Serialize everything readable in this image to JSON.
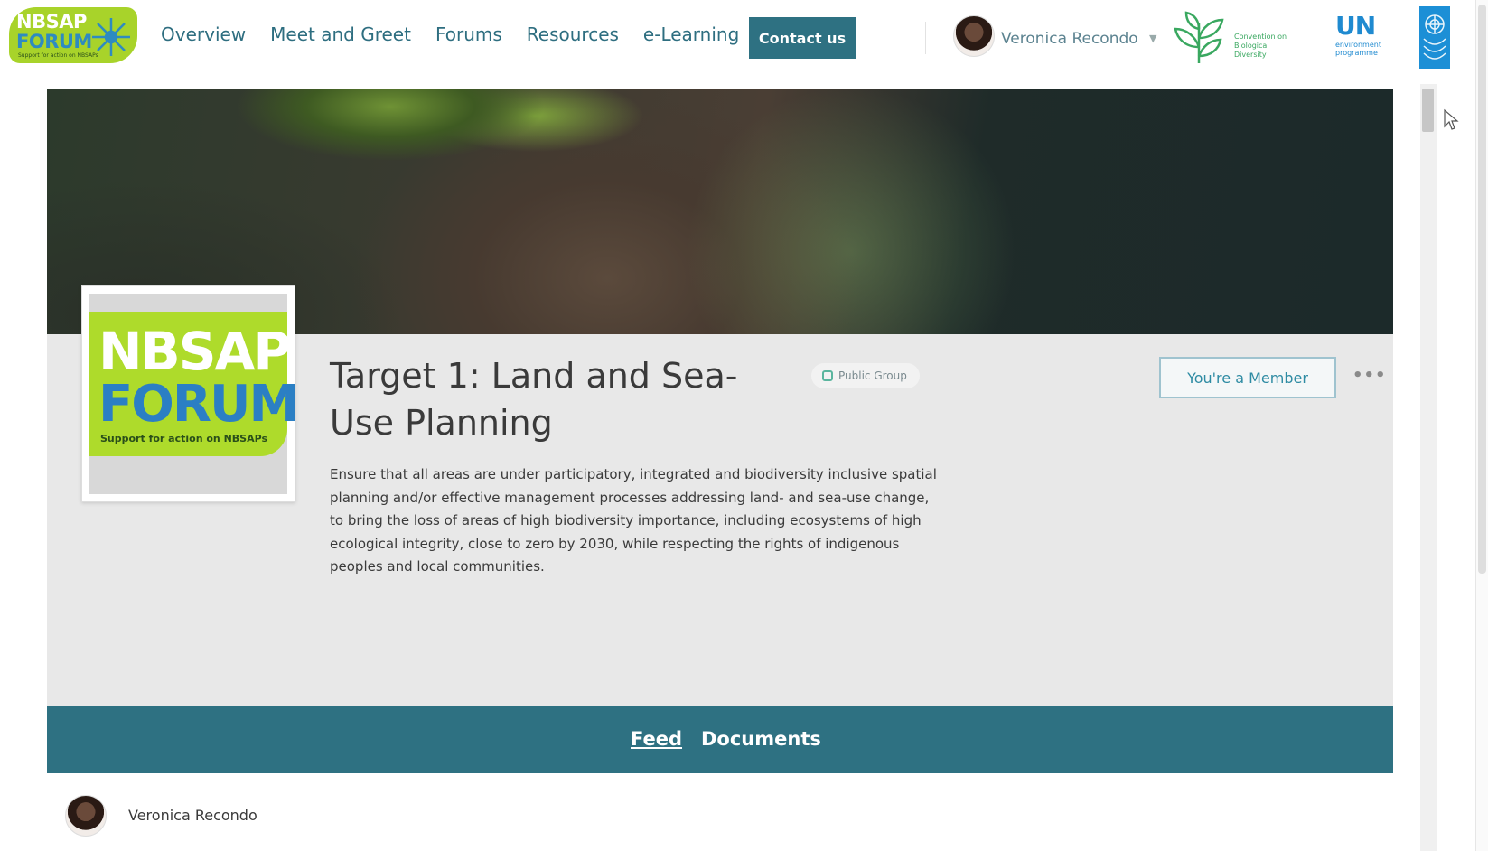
{
  "site": {
    "logo_line1": "NBSAP",
    "logo_line2": "FORUM",
    "logo_tagline": "Support for action on NBSAPs"
  },
  "nav": {
    "links": [
      "Overview",
      "Meet and Greet",
      "Forums",
      "Resources",
      "e-Learning"
    ],
    "contact_label": "Contact us"
  },
  "user": {
    "name": "Veronica Recondo"
  },
  "partners": {
    "cbd_text": "Convention on Biological Diversity",
    "un_text": "UN",
    "unep_text": "environment programme"
  },
  "group": {
    "title": "Target 1: Land and Sea-Use Planning",
    "privacy_badge": "Public Group",
    "member_button": "You're a Member",
    "more_label": "•••",
    "description": "Ensure that all areas are under participatory, integrated and biodiversity inclusive spatial planning and/or effective management processes addressing land- and sea-use change, to bring the loss of areas of high biodiversity importance, including ecosystems of high ecological integrity, close to zero by 2030, while respecting the rights of indigenous peoples and local communities."
  },
  "tabs": [
    "Feed",
    "Documents"
  ],
  "feed": {
    "author": "Veronica Recondo"
  },
  "colors": {
    "brand_teal": "#2e7182",
    "brand_green": "#a8d32a",
    "link_teal": "#2e6e80"
  }
}
